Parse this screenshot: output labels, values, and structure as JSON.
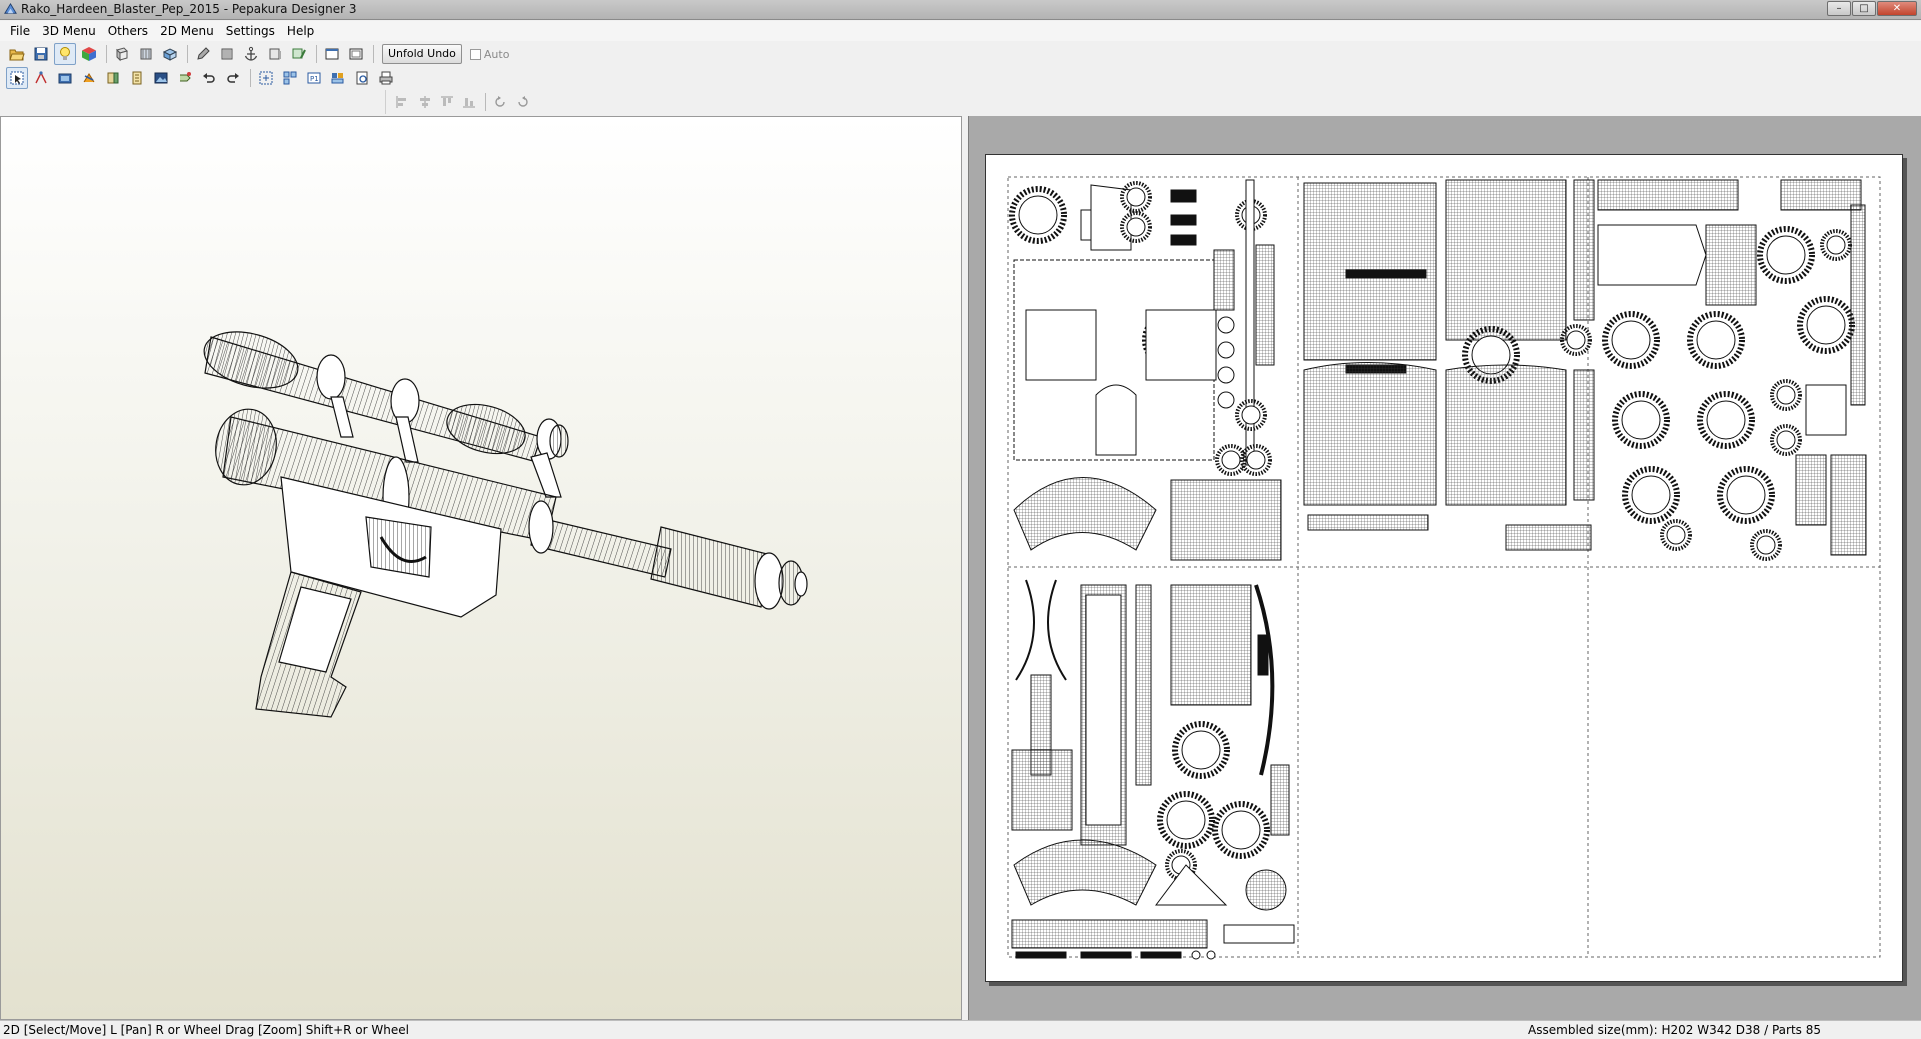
{
  "window": {
    "title": "Rako_Hardeen_Blaster_Pep_2015 - Pepakura Designer 3",
    "controls": [
      "minimize",
      "maximize",
      "close"
    ]
  },
  "menu": {
    "items": [
      "File",
      "3D Menu",
      "Others",
      "2D Menu",
      "Settings",
      "Help"
    ]
  },
  "toolbar_top": {
    "icons": [
      "open-icon",
      "save-icon",
      "lightbulb-icon",
      "color-cube-icon",
      "front-view-icon",
      "texture-icon",
      "pencil-icon",
      "flap-icon",
      "anchor-icon",
      "box-icon",
      "edit-icon",
      "frame-icon",
      "frame2-icon"
    ],
    "unfold_undo_label": "Unfold Undo",
    "auto_label": "Auto",
    "auto_checked": false
  },
  "toolbar_second": {
    "icons": [
      "select-icon",
      "join-icon",
      "scale-icon",
      "rotate-icon",
      "edit-edge-icon",
      "flap-toggle-icon",
      "image-icon",
      "move-icon",
      "undo-icon",
      "redo-icon",
      "arrange-icon",
      "zoom-fit-icon",
      "page-icon",
      "print-icon",
      "print-preview-icon",
      "printer-icon"
    ]
  },
  "toolbar_align": {
    "icons": [
      "align-left-icon",
      "align-center-icon",
      "align-top-icon",
      "align-bottom-icon",
      "rotate-ccw-icon",
      "rotate-cw-icon"
    ]
  },
  "status": {
    "left": "2D [Select/Move] L [Pan] R or Wheel Drag [Zoom] Shift+R or Wheel",
    "right": "Assembled size(mm): H202 W342 D38 / Parts 85"
  }
}
